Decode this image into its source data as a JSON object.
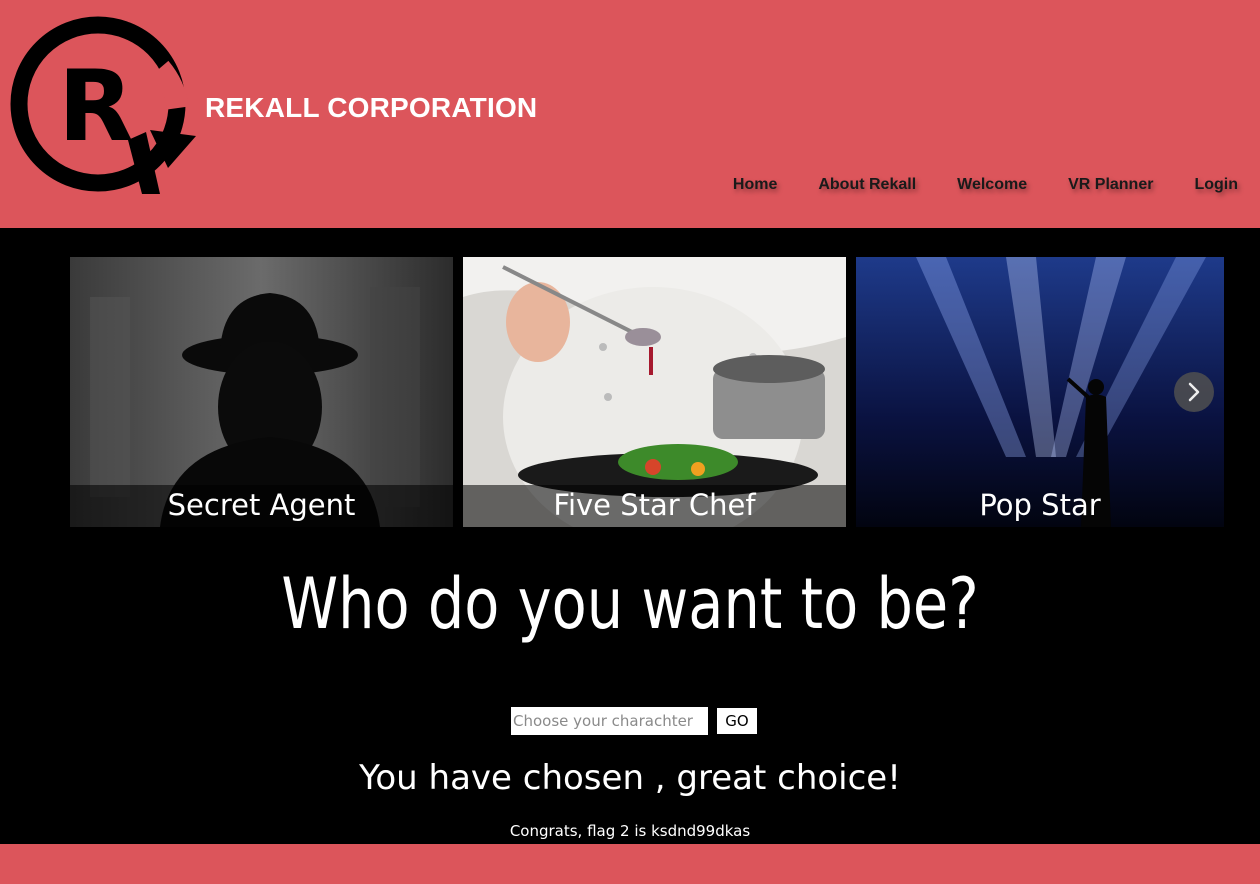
{
  "header": {
    "brand": "REKALL CORPORATION",
    "logo_icon": "rekall-r-logo-icon",
    "nav": [
      "Home",
      "About Rekall",
      "Welcome",
      "VR Planner",
      "Login"
    ],
    "bg_color": "#dc555b"
  },
  "carousel": {
    "slides": [
      {
        "caption": "Secret Agent",
        "image": "silhouette-fedora-man"
      },
      {
        "caption": "Five Star Chef",
        "image": "chef-plating-dish"
      },
      {
        "caption": "Pop Star",
        "image": "singer-on-stage-spotlights"
      }
    ],
    "next_icon": "chevron-right-icon"
  },
  "main": {
    "headline": "Who do you want to be?",
    "input_placeholder": "Choose your charachter",
    "input_value": "",
    "go_label": "GO",
    "result": "You have chosen , great choice!",
    "flag": "Congrats, flag 2 is ksdnd99dkas"
  }
}
